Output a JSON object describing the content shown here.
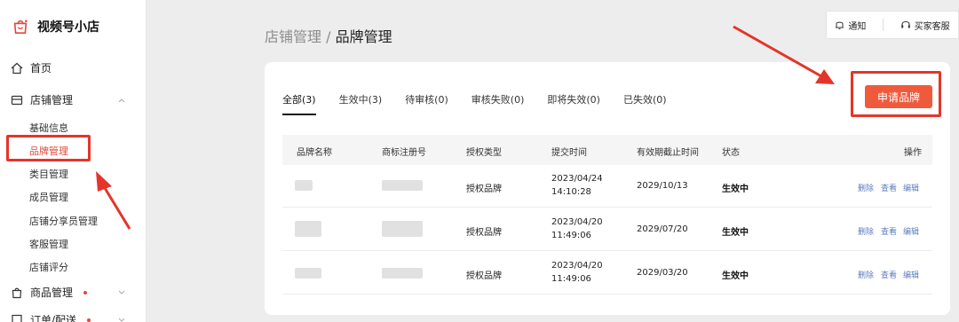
{
  "brand": {
    "title": "视频号小店",
    "accent": "#e8463a"
  },
  "sidebar": {
    "home": "首页",
    "store_mgmt": "店铺管理",
    "sub_items": [
      "基础信息",
      "品牌管理",
      "类目管理",
      "成员管理",
      "店铺分享员管理",
      "客服管理",
      "店铺评分"
    ],
    "active_sub": "品牌管理",
    "goods_mgmt": "商品管理",
    "orders": "订单/配送"
  },
  "topbar": {
    "notify": "通知",
    "service": "买家客服"
  },
  "breadcrumb": {
    "parent": "店铺管理",
    "sep": "/",
    "current": "品牌管理"
  },
  "tabs": [
    "全部(3)",
    "生效中(3)",
    "待审核(0)",
    "审核失败(0)",
    "即将失效(0)",
    "已失效(0)"
  ],
  "apply_button": "申请品牌",
  "table": {
    "headers": [
      "品牌名称",
      "商标注册号",
      "授权类型",
      "提交时间",
      "有效期截止时间",
      "状态",
      "操作"
    ],
    "rows": [
      {
        "type": "授权品牌",
        "submit_date": "2023/04/24",
        "submit_time": "14:10:28",
        "expiry": "2029/10/13",
        "status": "生效中"
      },
      {
        "type": "授权品牌",
        "submit_date": "2023/04/20",
        "submit_time": "11:49:06",
        "expiry": "2029/07/20",
        "status": "生效中"
      },
      {
        "type": "授权品牌",
        "submit_date": "2023/04/20",
        "submit_time": "11:49:06",
        "expiry": "2029/03/20",
        "status": "生效中"
      }
    ],
    "ops": [
      "删除",
      "查看",
      "编辑"
    ]
  }
}
